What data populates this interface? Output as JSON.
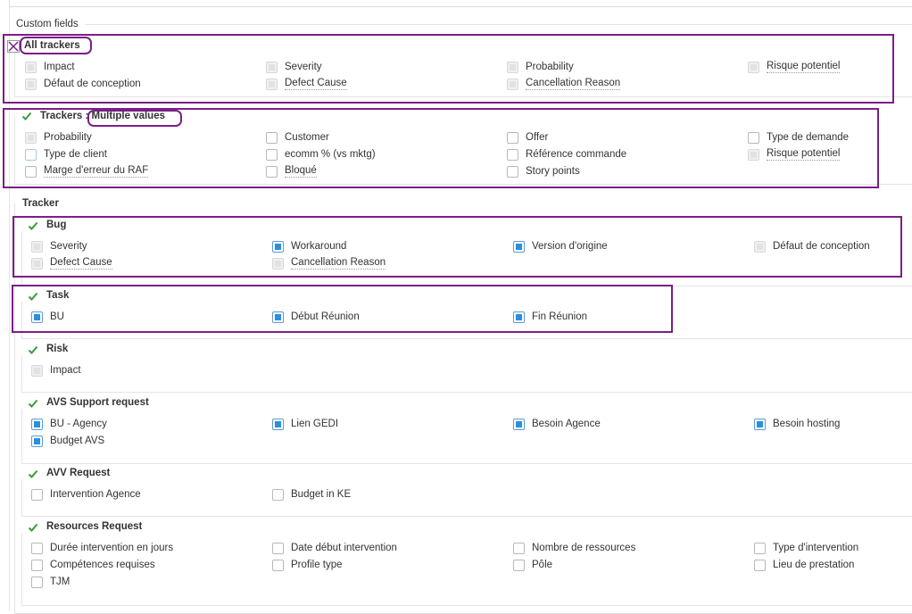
{
  "custom_fields_title": "Custom fields",
  "all_trackers": {
    "label": "All trackers",
    "fields": [
      {
        "label": "Impact",
        "state": "disabled",
        "underline": false
      },
      {
        "label": "Severity",
        "state": "disabled",
        "underline": false
      },
      {
        "label": "Probability",
        "state": "disabled",
        "underline": false
      },
      {
        "label": "Risque potentiel",
        "state": "disabled",
        "underline": true
      },
      {
        "label": "Défaut de conception",
        "state": "disabled",
        "underline": false
      },
      {
        "label": "Defect Cause",
        "state": "disabled",
        "underline": true
      },
      {
        "label": "Cancellation Reason",
        "state": "disabled",
        "underline": true
      }
    ]
  },
  "multiple_values": {
    "label_prefix": "Trackers : ",
    "label_highlight": "Multiple values",
    "fields": [
      {
        "label": "Probability",
        "state": "disabled",
        "underline": false
      },
      {
        "label": "Customer",
        "state": "unchecked",
        "underline": false
      },
      {
        "label": "Offer",
        "state": "unchecked",
        "underline": false
      },
      {
        "label": "Type de demande",
        "state": "unchecked",
        "underline": false
      },
      {
        "label": "Type de client",
        "state": "unchecked-blue",
        "underline": false
      },
      {
        "label": "ecomm % (vs mktg)",
        "state": "unchecked",
        "underline": false
      },
      {
        "label": "Référence commande",
        "state": "unchecked",
        "underline": false
      },
      {
        "label": "Risque potentiel",
        "state": "disabled",
        "underline": true
      },
      {
        "label": "Marge d'erreur du RAF",
        "state": "unchecked",
        "underline": true
      },
      {
        "label": "Bloqué",
        "state": "unchecked",
        "underline": true
      },
      {
        "label": "Story points",
        "state": "unchecked",
        "underline": false
      }
    ]
  },
  "tracker_title": "Tracker",
  "trackers": [
    {
      "name": "Bug",
      "fields": [
        {
          "label": "Severity",
          "state": "disabled"
        },
        {
          "label": "Workaround",
          "state": "checked"
        },
        {
          "label": "Version d'origine",
          "state": "checked"
        },
        {
          "label": "Défaut de conception",
          "state": "disabled"
        },
        {
          "label": "Defect Cause",
          "state": "disabled",
          "underline": true
        },
        {
          "label": "Cancellation Reason",
          "state": "disabled",
          "underline": true
        }
      ]
    },
    {
      "name": "Task",
      "fields": [
        {
          "label": "BU",
          "state": "checked"
        },
        {
          "label": "Début Réunion",
          "state": "checked"
        },
        {
          "label": "Fin Réunion",
          "state": "checked"
        }
      ]
    },
    {
      "name": "Risk",
      "fields": [
        {
          "label": "Impact",
          "state": "disabled"
        }
      ]
    },
    {
      "name": "AVS Support request",
      "fields": [
        {
          "label": "BU - Agency",
          "state": "checked"
        },
        {
          "label": "Lien GEDI",
          "state": "checked"
        },
        {
          "label": "Besoin Agence",
          "state": "checked"
        },
        {
          "label": "Besoin hosting",
          "state": "checked"
        },
        {
          "label": "Budget AVS",
          "state": "checked"
        }
      ]
    },
    {
      "name": "AVV Request",
      "fields": [
        {
          "label": "Intervention Agence",
          "state": "unchecked"
        },
        {
          "label": "Budget in KE",
          "state": "unchecked"
        }
      ]
    },
    {
      "name": "Resources Request",
      "fields": [
        {
          "label": "Durée intervention en jours",
          "state": "unchecked"
        },
        {
          "label": "Date début intervention",
          "state": "unchecked"
        },
        {
          "label": "Nombre de ressources",
          "state": "unchecked"
        },
        {
          "label": "Type d'intervention",
          "state": "unchecked"
        },
        {
          "label": "Compétences requises",
          "state": "unchecked"
        },
        {
          "label": "Profile type",
          "state": "unchecked"
        },
        {
          "label": "Pôle",
          "state": "unchecked"
        },
        {
          "label": "Lieu de prestation",
          "state": "unchecked"
        },
        {
          "label": "TJM",
          "state": "unchecked"
        }
      ]
    }
  ],
  "colors": {
    "highlight": "#7a1f86",
    "checked": "#2a8fe0",
    "checkmark": "#3a9a3a"
  }
}
